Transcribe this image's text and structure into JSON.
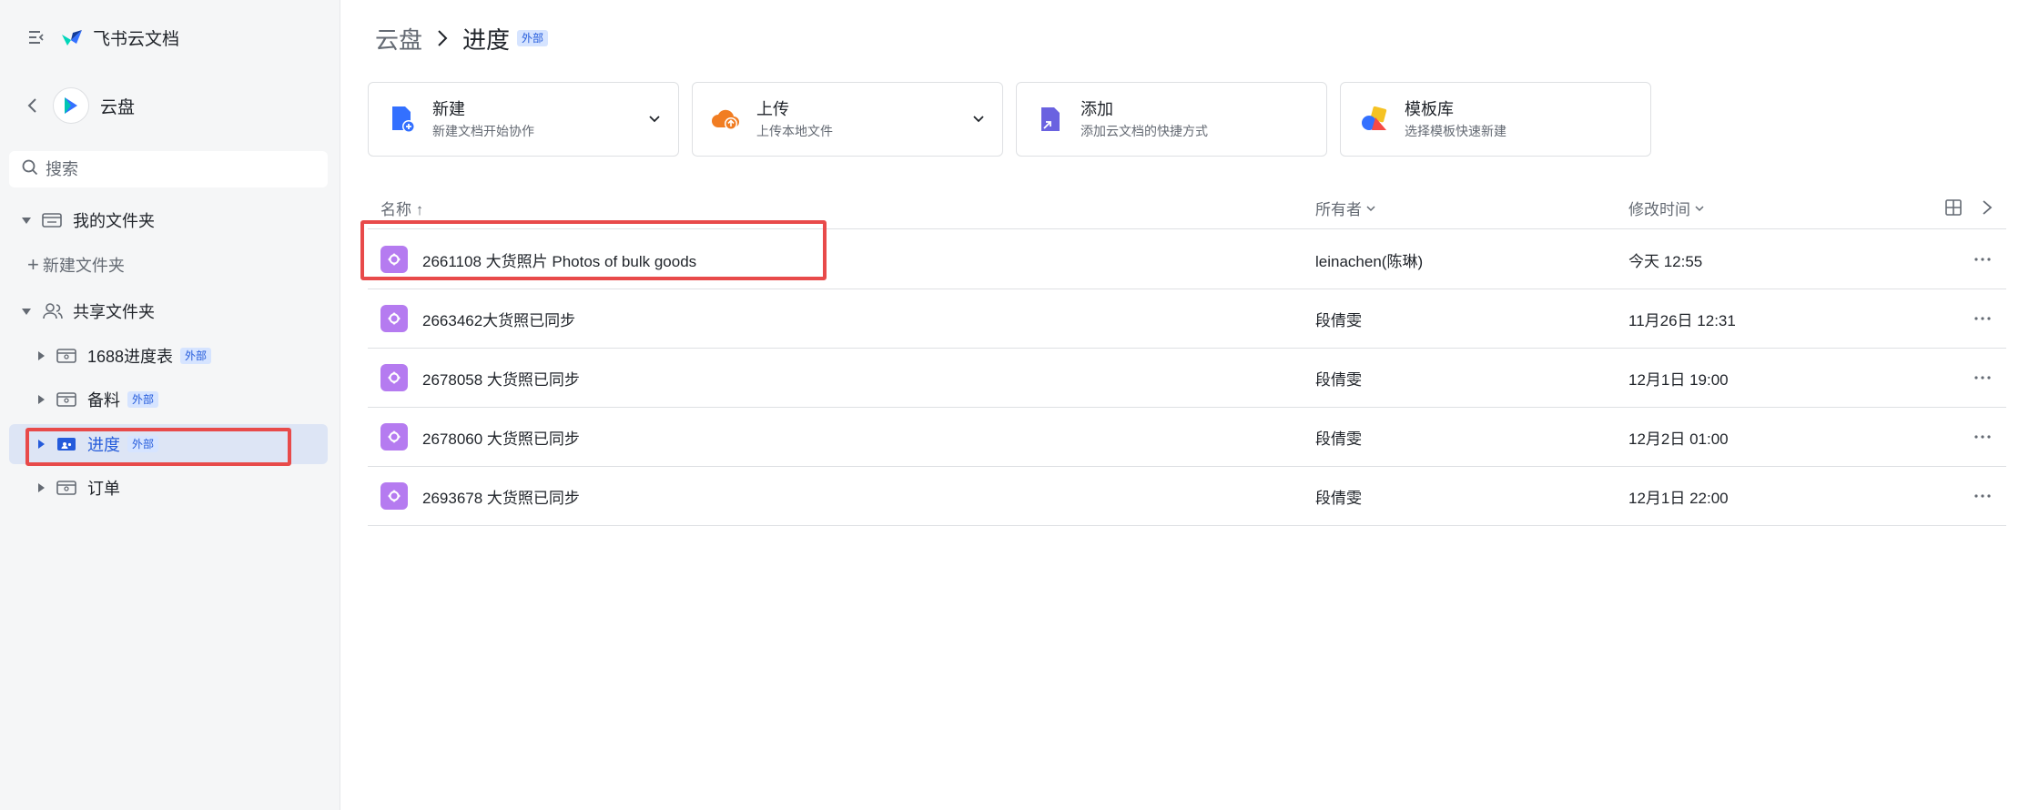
{
  "app": {
    "title": "飞书云文档"
  },
  "sidebar": {
    "drive_label": "云盘",
    "search_placeholder": "搜索",
    "my_folder": "我的文件夹",
    "new_folder": "新建文件夹",
    "shared_folder": "共享文件夹",
    "shared_items": [
      {
        "label": "1688进度表",
        "badge": "外部"
      },
      {
        "label": "备料",
        "badge": "外部"
      },
      {
        "label": "进度",
        "badge": "外部",
        "active": true
      },
      {
        "label": "订单",
        "badge": ""
      }
    ]
  },
  "breadcrumb": {
    "root": "云盘",
    "current": "进度",
    "badge": "外部"
  },
  "cards": [
    {
      "title": "新建",
      "subtitle": "新建文档开始协作",
      "icon": "new-doc-icon"
    },
    {
      "title": "上传",
      "subtitle": "上传本地文件",
      "icon": "upload-cloud-icon"
    },
    {
      "title": "添加",
      "subtitle": "添加云文档的快捷方式",
      "icon": "shortcut-icon"
    },
    {
      "title": "模板库",
      "subtitle": "选择模板快速新建",
      "icon": "template-icon"
    }
  ],
  "table": {
    "headers": {
      "name": "名称 ↑",
      "owner": "所有者",
      "modified": "修改时间"
    },
    "rows": [
      {
        "name": "2661108 大货照片 Photos of bulk goods",
        "owner": "leinachen(陈琳)",
        "modified": "今天 12:55"
      },
      {
        "name": "2663462大货照已同步",
        "owner": "段倩雯",
        "modified": "11月26日 12:31"
      },
      {
        "name": "2678058 大货照已同步",
        "owner": "段倩雯",
        "modified": "12月1日 19:00"
      },
      {
        "name": "2678060 大货照已同步",
        "owner": "段倩雯",
        "modified": "12月2日 01:00"
      },
      {
        "name": "2693678 大货照已同步",
        "owner": "段倩雯",
        "modified": "12月1日 22:00"
      }
    ]
  },
  "colors": {
    "accent": "#245bdb",
    "highlight": "#e84a4a",
    "file_icon": "#b57bf0"
  }
}
